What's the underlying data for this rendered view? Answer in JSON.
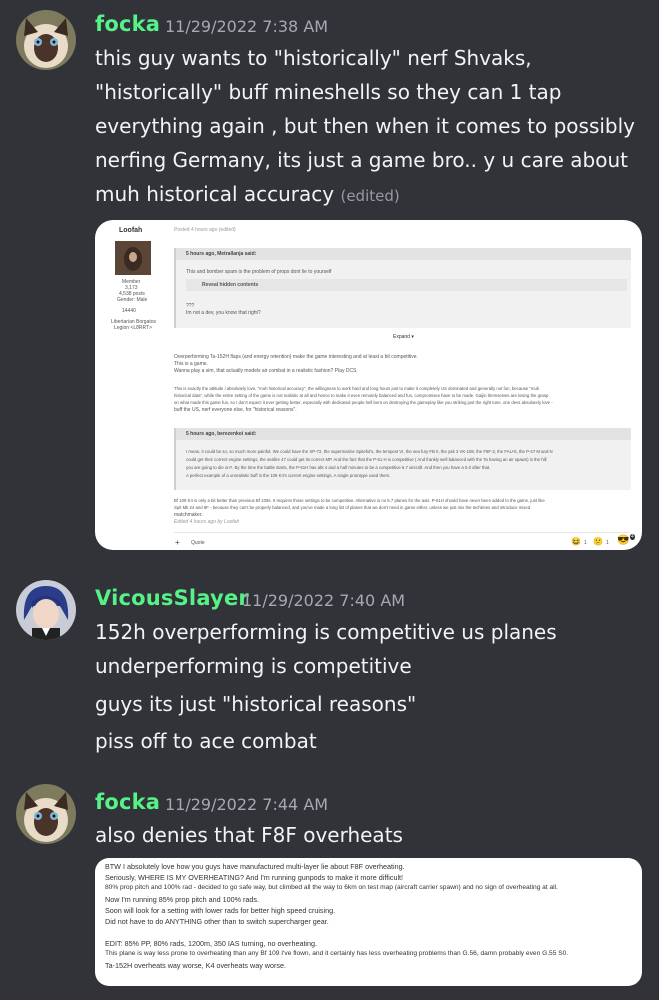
{
  "messages": [
    {
      "username": "focka",
      "username_color": "#57f287",
      "timestamp": "11/29/2022 7:38 AM",
      "lines": [
        "this guy wants to \"historically\" nerf Shvaks,",
        "\"historically\" buff mineshells so they can 1 tap",
        "everything again , but then when it comes to possibly",
        "nerfing Germany, its just a game bro.. y u care about",
        "muh historical accuracy"
      ],
      "edited_label": "(edited)"
    },
    {
      "username": "VicousSlayer",
      "username_color": "#57f287",
      "timestamp": "11/29/2022 7:40 AM",
      "lines": [
        "152h overperforming is competitive us planes",
        "underperforming is competitive",
        "guys its just \"historical reasons\"",
        "piss off to ace combat"
      ]
    },
    {
      "username": "focka",
      "username_color": "#57f287",
      "timestamp": "11/29/2022 7:44 AM",
      "lines": [
        "also denies that F8F overheats"
      ]
    }
  ],
  "forum_post": {
    "author": "Loofah",
    "posted": "Posted 4 hours ago (edited)",
    "member_title": "Member",
    "rep": "3,173",
    "posts": "4,538 posts",
    "gender": "Gender: Male",
    "rank": "14440",
    "clan": "Libertarian Borgatos",
    "clan2": "Legion <L8RRT>",
    "quote1_head": "5 hours ago, Metrallanja said:",
    "quote1_line": "This and bomber spam is the problem of props dont lie to yourself",
    "reveal": "Reveal hidden contents",
    "quote1_extra": [
      "???",
      "Im not a dev, you know that right?"
    ],
    "expand": "Expand ▾",
    "body1": [
      "Overperforming Ta-152H flaps (and energy retention) make the game interesting and at least a bit competitive.",
      "This is a game.",
      "Wanna play a sim, that actually models air combat in a realistic fashion? Play DCS."
    ],
    "body2": [
      "This is exactly the attitude i absolutely love, \"muh historical accuracy\", the willingness to work hard and long hours just to make it completely US dominated and generally not fun, because \"muh",
      "historical data\", while the entire setting of the game is not realistic at all and hence to make it even remotely balanced and fun, compromises have to be made. Gaijin themselves are losing the grasp",
      "on what made this game fun, so I don't expect it ever getting better, especially with dedicated people hell bent on destroying the gameplay like you striking just the right tune, one devs absolutely love -",
      "buff the US, nerf everyone else, for \"historical reasons\"."
    ],
    "quote2_head": "5 hours ago, berezenkoi said:",
    "quote2_lines": [
      "I mean, it could be so, so much more painful. We could have the XP-72, the supermarine Spiteful's, the tempest VI, the sea fury FB II, the yak 3 VK-108, the F8F-2, the FAU-5, the P-47 M and N",
      "could get their correct engine settings, the seafire 47 could get its correct MP. And the fact that the P-51 H is competitive ( And frankly well balanced with the Ta having an air spawn) is the hill",
      "you are going to die on?. By the time the battle starts, the P-51H has abt 4 and a half minutes to be a competitive 6.7 aircraft. And then you have a 5.0 after that.",
      "A perfect example of a unrealistic buff is the 109 K4's current engine settings. A single prototype used them."
    ],
    "body3": [
      "Bf 109 K4 is only a bit better than previous Bf 109s. It requires those settings to be competitive. Alternative is no 5.7 planes for the axis. P-51H should have never been added to the game, just like",
      "Spit Mk 24 and 8F - because they can't be properly balanced, and you've made a long list of planes that we don't need in game either, unless we just mix the techtrees and introduce mixed",
      "matchmaker."
    ],
    "edited_by": "Edited 4 hours ago by Loofah",
    "quote_btn": "Quote",
    "reactions": [
      "1",
      "1",
      "4"
    ]
  },
  "second_embed": {
    "lines": [
      "BTW I absolutely love how you guys have manufactured multi-layer lie about F8F overheating.",
      "Seriously, WHERE IS MY OVERHEATING? And I'm running gunpods to make it more difficult!",
      "80% prop pitch and 100% rad - decided to go safe way, but climbed all the way to 6km on test map (aircraft carrier spawn) and no sign of overheating at all.",
      "Now I'm running 85% prop pitch and 100% rads.",
      "Soon will look for a setting with lower rads for better high speed cruising.",
      "Did not have to do ANYTHING other than to switch supercharger gear.",
      "",
      "EDIT: 85% PP, 80% rads, 1200m, 350 IAS turning, no overheating.",
      "This plane is way less prone to overheating than any Bf 109 I've flown, and it certainly has less overheating problems than G.56, damn probably even G.55 S0.",
      "Ta-152H overheats way worse, K4 overheats way worse."
    ]
  }
}
